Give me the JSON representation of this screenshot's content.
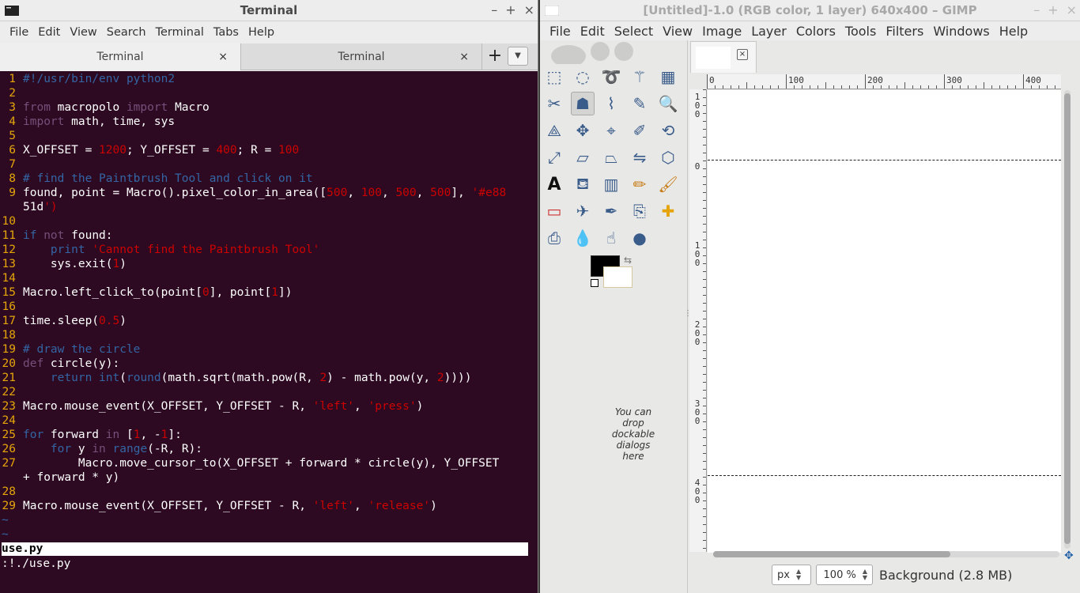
{
  "terminal": {
    "title": "Terminal",
    "menu": [
      "File",
      "Edit",
      "View",
      "Search",
      "Terminal",
      "Tabs",
      "Help"
    ],
    "tabs": [
      {
        "label": "Terminal"
      },
      {
        "label": "Terminal"
      }
    ],
    "tab_close": "×",
    "new_tab": "+",
    "tab_menu": "▼",
    "win_controls": {
      "minimize": "–",
      "maximize": "+",
      "close": "×"
    },
    "lines": [
      {
        "n": "1",
        "code": "#!/usr/bin/env python2"
      },
      {
        "n": "2",
        "code": ""
      },
      {
        "n": "3",
        "code": "from macropolo import Macro"
      },
      {
        "n": "4",
        "code": "import math, time, sys"
      },
      {
        "n": "5",
        "code": ""
      },
      {
        "n": "6",
        "code": "X_OFFSET = 1200; Y_OFFSET = 400; R = 100"
      },
      {
        "n": "7",
        "code": ""
      },
      {
        "n": "8",
        "code": "# find the Paintbrush Tool and click on it"
      },
      {
        "n": "9",
        "code": "found, point = Macro().pixel_color_in_area([500, 100, 500, 500], '#e88"
      },
      {
        "n": "",
        "code": "51d')"
      },
      {
        "n": "10",
        "code": ""
      },
      {
        "n": "11",
        "code": "if not found:"
      },
      {
        "n": "12",
        "code": "    print 'Cannot find the Paintbrush Tool'"
      },
      {
        "n": "13",
        "code": "    sys.exit(1)"
      },
      {
        "n": "14",
        "code": ""
      },
      {
        "n": "15",
        "code": "Macro.left_click_to(point[0], point[1])"
      },
      {
        "n": "16",
        "code": ""
      },
      {
        "n": "17",
        "code": "time.sleep(0.5)"
      },
      {
        "n": "18",
        "code": ""
      },
      {
        "n": "19",
        "code": "# draw the circle"
      },
      {
        "n": "20",
        "code": "def circle(y):"
      },
      {
        "n": "21",
        "code": "    return int(round(math.sqrt(math.pow(R, 2) - math.pow(y, 2))))"
      },
      {
        "n": "22",
        "code": ""
      },
      {
        "n": "23",
        "code": "Macro.mouse_event(X_OFFSET, Y_OFFSET - R, 'left', 'press')"
      },
      {
        "n": "24",
        "code": ""
      },
      {
        "n": "25",
        "code": "for forward in [1, -1]:"
      },
      {
        "n": "26",
        "code": "    for y in range(-R, R):"
      },
      {
        "n": "27",
        "code": "        Macro.move_cursor_to(X_OFFSET + forward * circle(y), Y_OFFSET"
      },
      {
        "n": "",
        "code": "+ forward * y)"
      },
      {
        "n": "28",
        "code": ""
      },
      {
        "n": "29",
        "code": "Macro.mouse_event(X_OFFSET, Y_OFFSET - R, 'left', 'release')"
      }
    ],
    "tildes": [
      "~",
      "~"
    ],
    "status_file": "use.py",
    "command": ":!./use.py"
  },
  "gimp": {
    "title": "[Untitled]-1.0 (RGB color, 1 layer) 640x400 – GIMP",
    "menu": [
      "File",
      "Edit",
      "Select",
      "View",
      "Image",
      "Layer",
      "Colors",
      "Tools",
      "Filters",
      "Windows",
      "Help"
    ],
    "win_controls": {
      "minimize": "–",
      "maximize": "+",
      "close": "×"
    },
    "tools": [
      "rect-select",
      "ellipse-select",
      "free-select",
      "fuzzy-select",
      "select-by-color",
      "scissors-select",
      "foreground-select",
      "paths",
      "color-picker",
      "zoom",
      "measure",
      "move",
      "align",
      "crop",
      "rotate",
      "scale",
      "shear",
      "perspective",
      "flip",
      "cage-transform",
      "text",
      "bucket-fill",
      "blend",
      "pencil",
      "paintbrush",
      "eraser",
      "airbrush",
      "ink",
      "clone",
      "heal",
      "perspective-clone",
      "blur",
      "smudge",
      "dodge-burn"
    ],
    "drop_hint": "You can drop dockable dialogs here",
    "ruler_h": [
      "0",
      "100",
      "200",
      "300",
      "400"
    ],
    "ruler_v": [
      "100",
      "0",
      "100",
      "200",
      "300",
      "400"
    ],
    "unit": "px",
    "zoom": "100 %",
    "layer_info": "Background (2.8 MB)",
    "image_tab_close": "×",
    "fg_color": "#000000",
    "bg_color": "#ffffff"
  }
}
